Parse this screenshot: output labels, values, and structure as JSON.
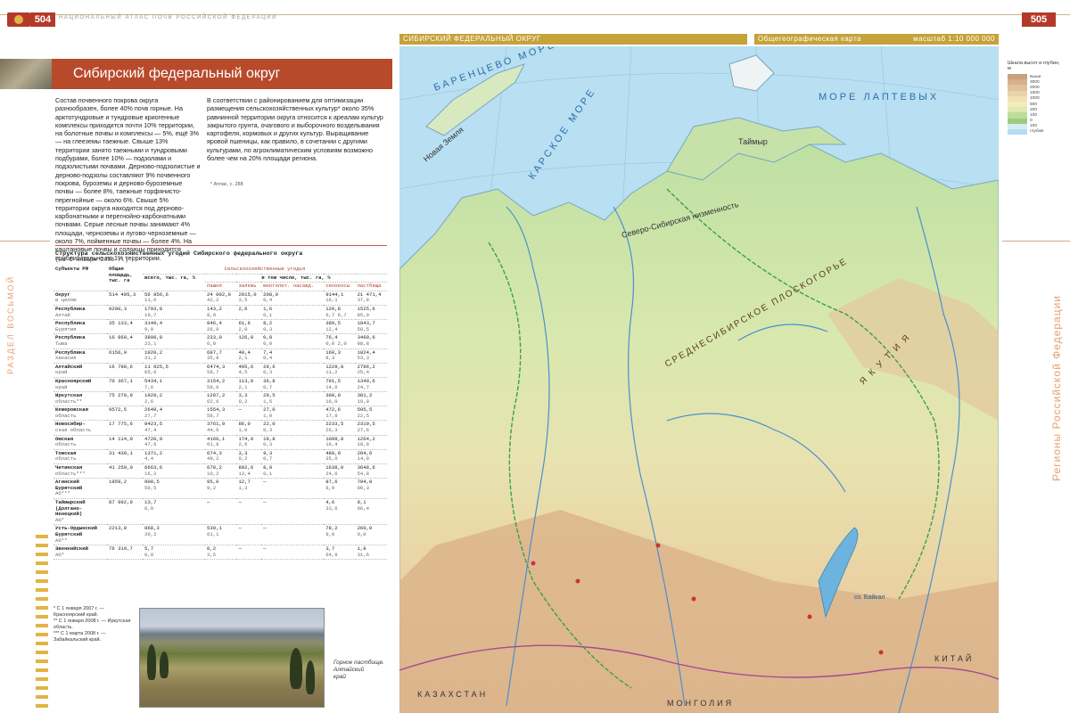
{
  "header": {
    "left_page_number": "504",
    "running_head": "Национальный атлас почв Российской Федерации",
    "right_page_number": "505"
  },
  "map_header": {
    "district": "СИБИРСКИЙ ФЕДЕРАЛЬНЫЙ ОКРУГ",
    "map_type": "Общегеографическая карта",
    "scale": "масштаб 1:10 000 000"
  },
  "article": {
    "title": "Сибирский федеральный округ",
    "col1": "Состав почвенного покрова округа разнообразен, более 40% почв горные. На арктотундровые и тундровые криогенные комплексы приходится почти 10% территории, на болотные почвы и комплексы — 5%, ещё 3% — на глееземы таежные. Свыше 13% территории занято таежными и тундровыми подбурами, более 10% — подзолами и подзолистыми почвами. Дерново-подзолистые и дерново-подзолы составляют 9% почвенного покрова, буроземы и дерново-буроземные почвы — более 8%, таежные торфянисто-перегнойные — около 6%. Свыше 5% территории округа находится под дерново-карбонатными и перегнойно-карбонатными почвами. Серые лесные почвы занимают 4% площади, черноземы и лугово-черноземные — около 7%, пойменные почвы — более 4%. На каштановые почвы и солонцы приходится приблизительно по 1% территории.",
    "col2": "В соответствии с районированием для оптимизации размещения сельскохозяйственных культур* около 35% равнинной территории округа относится к ареалам культур закрытого грунта, очагового и выборочного возделывания картофеля, кормовых и других культур. Выращивание яровой пшеницы, как правило, в сочетании с другими культурами, по агроклиматическим условиям возможно более чем на 20% площади региона.",
    "col2_note": "* Атлас, с. 288"
  },
  "table": {
    "title": "Структура сельскохозяйственных угодий Сибирского федерального округа",
    "subtitle": "(на 1 января 2006 г.)",
    "head_subjects": "Субъекты РФ",
    "head_area": "Общая площадь, тыс. га",
    "head_agri": "Сельскохозяйственные угодья",
    "head_total": "всего, тыс. га, %",
    "head_incl": "в том числе, тыс. га, %",
    "cols": [
      "пашня",
      "залежь",
      "многолет. насажд.",
      "сенокосы",
      "пастбища"
    ],
    "rows": [
      {
        "name": "Округ",
        "sub": "в целом",
        "area": "514 495,3",
        "total": [
          "56 856,6",
          "11,0"
        ],
        "c1": [
          "24 002,0",
          "42,2"
        ],
        "c2": [
          "2015,0",
          "3,5"
        ],
        "c3": [
          "208,9",
          "0,4"
        ],
        "c4": [
          "9144,1",
          "16,1"
        ],
        "c5": [
          "21 471,4",
          "37,8"
        ]
      },
      {
        "name": "Республика",
        "sub": "Алтай",
        "area": "9290,3",
        "total": [
          "1793,8",
          "19,7"
        ],
        "c1": [
          "143,2",
          "8,0"
        ],
        "c2": [
          "2,6",
          ""
        ],
        "c3": [
          "1,6",
          "0,1"
        ],
        "c4": [
          "120,8",
          "6,7 6,7"
        ],
        "c5": [
          "1525,6",
          "85,0"
        ]
      },
      {
        "name": "Республика",
        "sub": "Бурятия",
        "area": "35 133,4",
        "total": [
          "3149,4",
          "9,0"
        ],
        "c1": [
          "846,4",
          "26,9"
        ],
        "c2": [
          "61,6",
          "2,0"
        ],
        "c3": [
          "8,2",
          "0,3"
        ],
        "c4": [
          "389,5",
          "12,4"
        ],
        "c5": [
          "1843,7",
          "58,5"
        ]
      },
      {
        "name": "Республика",
        "sub": "Тыва",
        "area": "16 860,4",
        "total": [
          "3896,8",
          "23,1"
        ],
        "c1": [
          "233,0",
          "6,0"
        ],
        "c2": [
          "126,0",
          ""
        ],
        "c3": [
          "0,8",
          "0,0"
        ],
        "c4": [
          "76,4",
          "0,0 2,0"
        ],
        "c5": [
          "3460,6",
          "88,8"
        ]
      },
      {
        "name": "Республика",
        "sub": "Хакасия",
        "area": "6156,9",
        "total": [
          "1920,2",
          "31,2"
        ],
        "c1": [
          "687,7",
          "35,8"
        ],
        "c2": [
          "40,4",
          "2,1"
        ],
        "c3": [
          "7,4",
          "0,4"
        ],
        "c4": [
          "160,3",
          "8,3"
        ],
        "c5": [
          "1024,4",
          "53,3"
        ]
      },
      {
        "name": "Алтайский",
        "sub": "край",
        "area": "16 798,6",
        "total": [
          "11 025,5",
          "65,6"
        ],
        "c1": [
          "6474,3",
          "58,7"
        ],
        "c2": [
          "495,6",
          "4,5"
        ],
        "c3": [
          "29,6",
          "0,3"
        ],
        "c4": [
          "1229,8",
          "11,2"
        ],
        "c5": [
          "2796,2",
          "25,4"
        ]
      },
      {
        "name": "Красноярский",
        "sub": "край",
        "area": "70 367,1",
        "total": [
          "5434,1",
          "7,6"
        ],
        "c1": [
          "3154,2",
          "58,0"
        ],
        "c2": [
          "113,0",
          "2,1"
        ],
        "c3": [
          "36,8",
          "0,7"
        ],
        "c4": [
          "791,5",
          "14,6"
        ],
        "c5": [
          "1340,6",
          "24,7"
        ]
      },
      {
        "name": "Иркутская",
        "sub": "область**",
        "area": "75 270,9",
        "total": [
          "1929,2",
          "2,6"
        ],
        "c1": [
          "1207,2",
          "62,6"
        ],
        "c2": [
          "3,3",
          "0,2"
        ],
        "c3": [
          "29,5",
          "1,5"
        ],
        "c4": [
          "308,9",
          "16,0"
        ],
        "c5": [
          "381,2",
          "19,8"
        ]
      },
      {
        "name": "Кемеровская",
        "sub": "область",
        "area": "9572,5",
        "total": [
          "2649,4",
          "27,7"
        ],
        "c1": [
          "1554,3",
          "58,7"
        ],
        "c2": [
          "—",
          ""
        ],
        "c3": [
          "27,0",
          "1,0"
        ],
        "c4": [
          "472,6",
          "17,8"
        ],
        "c5": [
          "595,5",
          "22,5"
        ]
      },
      {
        "name": "Новосибир-",
        "sub": "ская область",
        "area": "17 775,6",
        "total": [
          "8423,5",
          "47,4"
        ],
        "c1": [
          "3761,9",
          "44,6"
        ],
        "c2": [
          "86,0",
          "1,0"
        ],
        "c3": [
          "22,0",
          "0,3"
        ],
        "c4": [
          "2233,5",
          "26,3"
        ],
        "c5": [
          "2319,5",
          "27,6"
        ]
      },
      {
        "name": "Омская",
        "sub": "область",
        "area": "14 114,0",
        "total": [
          "4720,9",
          "47,6"
        ],
        "c1": [
          "4160,1",
          "61,8"
        ],
        "c2": [
          "174,9",
          "2,6"
        ],
        "c3": [
          "19,8",
          "0,3"
        ],
        "c4": [
          "1099,8",
          "16,4"
        ],
        "c5": [
          "1264,2",
          "18,8"
        ]
      },
      {
        "name": "Томская",
        "sub": "область",
        "area": "31 439,1",
        "total": [
          "1371,2",
          "4,4"
        ],
        "c1": [
          "674,3",
          "49,2"
        ],
        "c2": [
          "3,3",
          "0,2"
        ],
        "c3": [
          "9,3",
          "0,7"
        ],
        "c4": [
          "480,0",
          "35,0"
        ],
        "c5": [
          "204,6",
          "14,9"
        ]
      },
      {
        "name": "Читинская",
        "sub": "область***",
        "area": "41 250,0",
        "total": [
          "6663,6",
          "16,2"
        ],
        "c1": [
          "678,2",
          "10,2"
        ],
        "c2": [
          "892,6",
          "13,4"
        ],
        "c3": [
          "8,0",
          "0,1"
        ],
        "c4": [
          "1638,0",
          "24,6"
        ],
        "c5": [
          "3648,6",
          "54,8"
        ]
      },
      {
        "name": "Агинский Бурятский",
        "sub": "АО***",
        "area": "1959,2",
        "total": [
          "908,5",
          "50,5"
        ],
        "c1": [
          "95,0",
          "9,2"
        ],
        "c2": [
          "12,7",
          "1,3"
        ],
        "c3": [
          "—",
          ""
        ],
        "c4": [
          "87,6",
          "8,9"
        ],
        "c5": [
          "794,0",
          "80,3"
        ]
      },
      {
        "name": "Таймырский (Долгано-Ненецкий)",
        "sub": "АО*",
        "area": "87 992,9",
        "total": [
          "13,7",
          "0,0"
        ],
        "c1": [
          "—",
          ""
        ],
        "c2": [
          "—",
          ""
        ],
        "c3": [
          "—",
          ""
        ],
        "c4": [
          "4,6",
          "33,6"
        ],
        "c5": [
          "9,1",
          "66,4"
        ]
      },
      {
        "name": "Усть-Ордынский Бурятский",
        "sub": "АО**",
        "area": "2213,8",
        "total": [
          "868,3",
          "39,2"
        ],
        "c1": [
          "530,1",
          "61,1"
        ],
        "c2": [
          "—",
          ""
        ],
        "c3": [
          "—",
          ""
        ],
        "c4": [
          "78,2",
          "9,0"
        ],
        "c5": [
          "260,0",
          "9,0"
        ]
      },
      {
        "name": "Эвенкийский",
        "sub": "АО*",
        "area": "76 319,7",
        "total": [
          "5,7",
          "0,0"
        ],
        "c1": [
          "0,2",
          "3,5"
        ],
        "c2": [
          "—",
          ""
        ],
        "c3": [
          "—",
          ""
        ],
        "c4": [
          "3,7",
          "64,9"
        ],
        "c5": [
          "1,8",
          "31,6"
        ]
      }
    ]
  },
  "footnotes": [
    "* С 1 января 2007 г. — Красноярский край.",
    "** С 1 января 2008 г. — Иркутская область.",
    "*** С 1 марта 2008 г. — Забайкальский край."
  ],
  "photo_caption": [
    "Горное пастбище.",
    "Алтайский",
    "край"
  ],
  "side_labels": {
    "left": "РАЗДЕЛ ВОСЬМОЙ",
    "right": "Регионы Российской Федерации"
  },
  "legend": {
    "title": "Шкала высот и глубин, м",
    "levels": [
      {
        "label": "выше",
        "color": "#c9a17c"
      },
      {
        "label": "3000",
        "color": "#d6b08e"
      },
      {
        "label": "2000",
        "color": "#e0c19b"
      },
      {
        "label": "1500",
        "color": "#ead3a8"
      },
      {
        "label": "1000",
        "color": "#f1e2b4"
      },
      {
        "label": "500",
        "color": "#f3ecbe"
      },
      {
        "label": "200",
        "color": "#dfeab0"
      },
      {
        "label": "100",
        "color": "#bcdd98"
      },
      {
        "label": "0",
        "color": "#9ccc80"
      },
      {
        "label": "100",
        "color": "#d7ecf4"
      },
      {
        "label": "глубже",
        "color": "#b5dcee"
      }
    ]
  },
  "map_labels": {
    "barents": "БАРЕНЦЕВО МОРЕ",
    "kara": "КАРСКОЕ МОРЕ",
    "laptev": "МОРЕ ЛАПТЕВЫХ",
    "novaya_zemlya": "Новая Земля",
    "taymyr": "Таймыр",
    "plateau": "СРЕДНЕСИБИРСКОЕ ПЛОСКОГОРЬЕ",
    "lowland": "Северо-Сибирская низменность",
    "yakutia": "Я К У Т И Я",
    "baikal": "оз. Байкал",
    "kazakhstan": "КАЗАХСТАН",
    "mongolia": "МОНГОЛИЯ",
    "china": "КИТАЙ"
  }
}
